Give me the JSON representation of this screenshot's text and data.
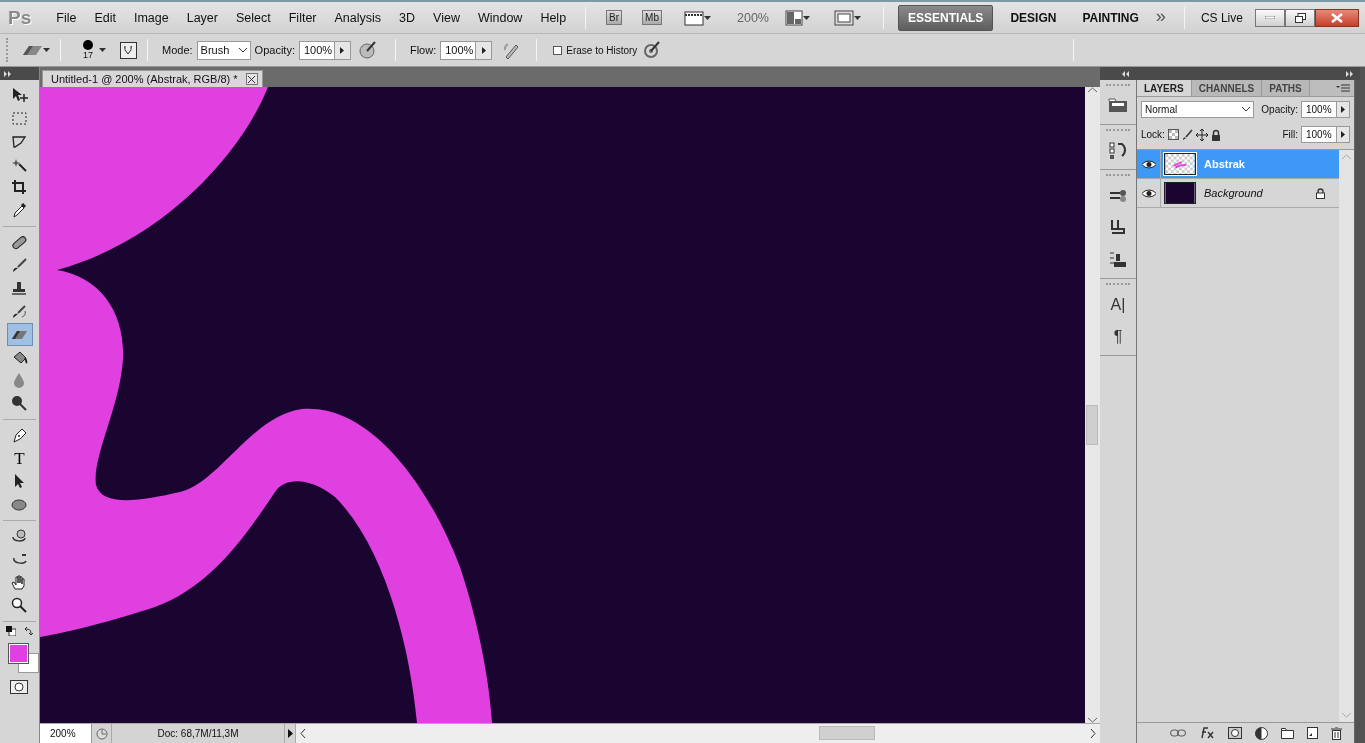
{
  "app": {
    "logo": "Ps",
    "menu": [
      "File",
      "Edit",
      "Image",
      "Layer",
      "Select",
      "Filter",
      "Analysis",
      "3D",
      "View",
      "Window",
      "Help"
    ],
    "bridge": "Br",
    "mini_bridge": "Mb",
    "zoom": "200%",
    "workspaces": [
      {
        "label": "ESSENTIALS",
        "selected": true
      },
      {
        "label": "DESIGN",
        "selected": false
      },
      {
        "label": "PAINTING",
        "selected": false
      }
    ],
    "more_workspaces": "»",
    "cs_live": "CS Live"
  },
  "options": {
    "brush_size": "17",
    "mode_label": "Mode:",
    "mode": "Brush",
    "opacity_label": "Opacity:",
    "opacity": "100%",
    "flow_label": "Flow:",
    "flow": "100%",
    "erase_to_history": {
      "label": "Erase to History",
      "checked": false
    }
  },
  "tool_groups": [
    {
      "tools": [
        {
          "kind": "move",
          "selected": false
        },
        {
          "kind": "marquee",
          "selected": false
        },
        {
          "kind": "lasso",
          "selected": false
        },
        {
          "kind": "wand",
          "selected": false
        },
        {
          "kind": "crop",
          "selected": false
        },
        {
          "kind": "eyedropper",
          "selected": false
        }
      ]
    },
    {
      "tools": [
        {
          "kind": "healing",
          "selected": false
        },
        {
          "kind": "brush",
          "selected": false
        },
        {
          "kind": "stamp",
          "selected": false
        },
        {
          "kind": "history",
          "selected": false
        },
        {
          "kind": "eraser",
          "selected": true
        },
        {
          "kind": "bucket",
          "selected": false
        },
        {
          "kind": "blur",
          "selected": false
        },
        {
          "kind": "dodge",
          "selected": false
        }
      ]
    },
    {
      "tools": [
        {
          "kind": "pen",
          "selected": false
        },
        {
          "kind": "type",
          "glyph": "T",
          "selected": false
        },
        {
          "kind": "path",
          "selected": false
        },
        {
          "kind": "shape",
          "selected": false
        }
      ]
    },
    {
      "tools": [
        {
          "kind": "rotate3d",
          "selected": false
        },
        {
          "kind": "orbit3d",
          "selected": false
        },
        {
          "kind": "hand",
          "selected": false
        },
        {
          "kind": "zoom",
          "selected": false
        }
      ]
    }
  ],
  "document": {
    "tab_title": "Untitled-1 @ 200% (Abstrak, RGB/8) *",
    "zoom": "200%",
    "info": "Doc: 68,7M/11,3M"
  },
  "dock_groups": [
    {
      "items": [
        {
          "kind": "folder"
        }
      ]
    },
    {
      "items": [
        {
          "kind": "history"
        }
      ]
    },
    {
      "items": [
        {
          "kind": "brushes"
        },
        {
          "kind": "clone"
        },
        {
          "kind": "presets"
        }
      ]
    },
    {
      "items": [
        {
          "kind": "character",
          "glyph": "A|"
        },
        {
          "kind": "paragraph",
          "glyph": "¶"
        }
      ]
    }
  ],
  "layers_panel": {
    "tabs": [
      {
        "label": "LAYERS",
        "selected": true
      },
      {
        "label": "CHANNELS",
        "selected": false
      },
      {
        "label": "PATHS",
        "selected": false
      }
    ],
    "blend_mode": "Normal",
    "opacity_label": "Opacity:",
    "opacity": "100%",
    "lock_label": "Lock:",
    "fill_label": "Fill:",
    "fill": "100%",
    "layers": [
      {
        "name": "Abstrak",
        "selected": true,
        "visible": true,
        "locked": false,
        "kind": "art"
      },
      {
        "name": "Background",
        "selected": false,
        "visible": true,
        "locked": true,
        "kind": "background"
      }
    ]
  }
}
